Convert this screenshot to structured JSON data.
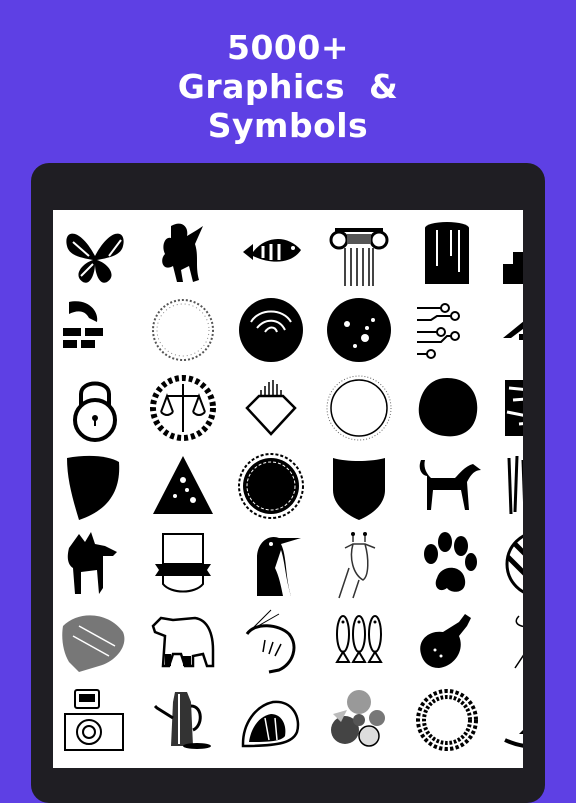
{
  "headline": {
    "line1": "5000+",
    "line2": "Graphics  &",
    "line3": "Symbols"
  },
  "colors": {
    "background": "#5E40E4",
    "device_frame": "#1F1E23",
    "screen": "#FFFFFF",
    "graphic": "#000000"
  },
  "graphics_grid": {
    "rows": [
      [
        "butterfly-icon",
        "rearing-horse-icon",
        "perch-fish-icon",
        "ionic-column-icon",
        "paint-can-icon",
        "city-skyline-icon"
      ],
      [
        "house-brick-icon",
        "laurel-wreath-circle-icon",
        "brush-swirl-circle-icon",
        "grunge-circle-icon",
        "circuit-lines-icon",
        "house-roof-icon"
      ],
      [
        "padlock-icon",
        "scales-of-justice-wreath-icon",
        "diamond-sunburst-icon",
        "dotted-ring-circle-icon",
        "ink-blob-icon",
        "grunge-texture-square-icon"
      ],
      [
        "shield-half-icon",
        "grunge-triangle-icon",
        "scalloped-seal-icon",
        "police-shield-icon",
        "dog-silhouette-icon",
        "brush-stroke-texture-icon"
      ],
      [
        "moose-icon",
        "ribbon-badge-icon",
        "penguin-icon",
        "giraffe-icon",
        "paw-print-icon",
        "striped-circle-icon"
      ],
      [
        "tree-sketch-icon",
        "bear-sketch-icon",
        "shrimp-icon",
        "three-fish-icon",
        "chicken-drumstick-icon",
        "abstract-scribble-icon"
      ],
      [
        "camera-icon",
        "coffee-pot-icon",
        "steak-icon",
        "fruit-pile-icon",
        "spirograph-ring-icon",
        "house-swoosh-logo-icon"
      ]
    ]
  }
}
